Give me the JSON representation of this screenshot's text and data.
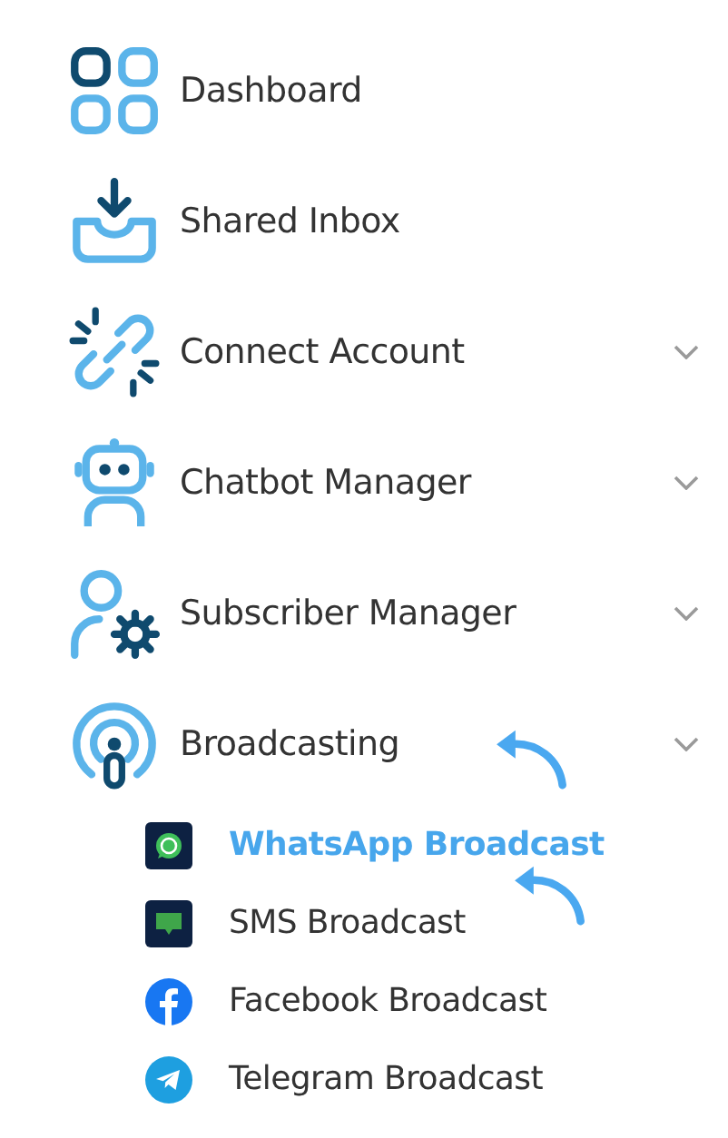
{
  "menu": [
    {
      "label": "Dashboard",
      "has_submenu": false
    },
    {
      "label": "Shared Inbox",
      "has_submenu": false
    },
    {
      "label": "Connect Account",
      "has_submenu": true
    },
    {
      "label": "Chatbot Manager",
      "has_submenu": true
    },
    {
      "label": "Subscriber Manager",
      "has_submenu": true
    },
    {
      "label": "Broadcasting",
      "has_submenu": true,
      "children": [
        {
          "label": "WhatsApp Broadcast",
          "selected": true
        },
        {
          "label": "SMS Broadcast",
          "selected": false
        },
        {
          "label": "Facebook Broadcast",
          "selected": false
        },
        {
          "label": "Telegram Broadcast",
          "selected": false
        }
      ]
    }
  ]
}
